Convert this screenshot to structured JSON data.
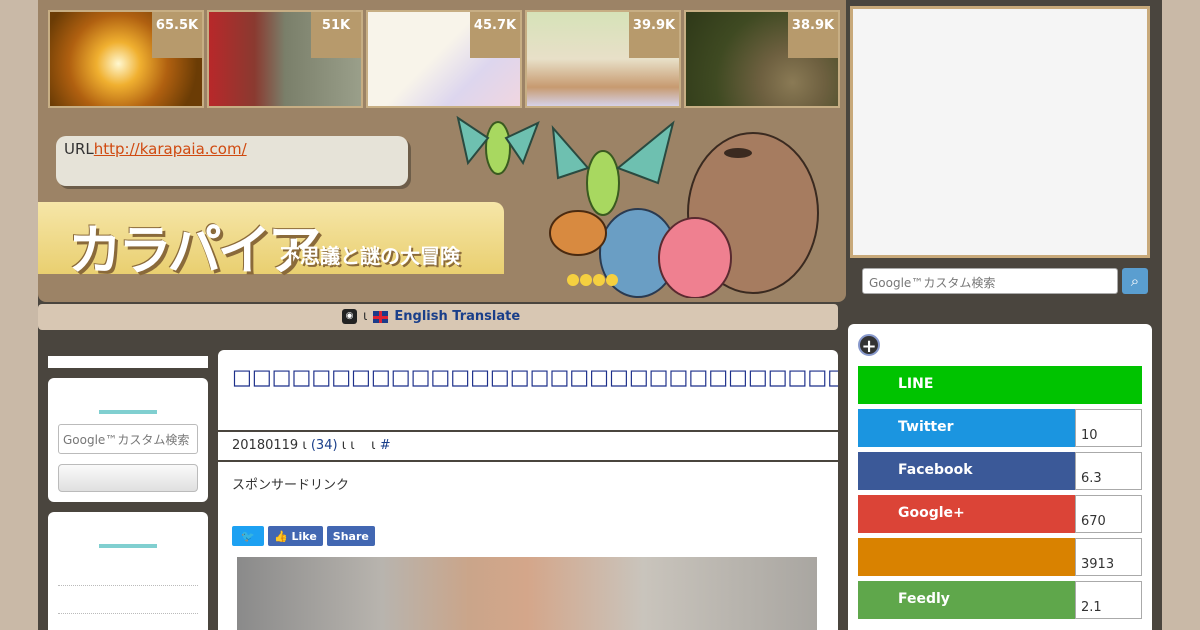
{
  "thumbnails": [
    {
      "count": "65.5K",
      "colors": [
        "#6b3c05",
        "#f0b030",
        "#ffe9a0"
      ]
    },
    {
      "count": "51K",
      "colors": [
        "#b8282a",
        "#7a7f6a",
        "#9a9f8a"
      ]
    },
    {
      "count": "45.7K",
      "colors": [
        "#f8f4ea",
        "#ddd6ee",
        "#f0d6e0"
      ]
    },
    {
      "count": "39.9K",
      "colors": [
        "#d6e2b8",
        "#c79a70",
        "#e8e0c8"
      ]
    },
    {
      "count": "38.9K",
      "colors": [
        "#3f4a22",
        "#6e6040",
        "#8a7a55"
      ]
    }
  ],
  "header": {
    "url_prefix": "URL",
    "url_text": "http://karapaia.com/",
    "logo_main": "カラパイア",
    "logo_sub": "不思議と謎の大冒険"
  },
  "translate": {
    "globe_icon": "globe-icon",
    "sep": "ι",
    "label": "English Translate"
  },
  "left_sidebar": {
    "search_placeholder": "Google™カスタム検索"
  },
  "article": {
    "title": "□□□□□□□□□□□□□□□□□□□□□□□□□□□□□□□□□□□□□□□□□□□□□□□□□□□□□□□□□",
    "date": "20180119",
    "sep1": "ι",
    "comments": "(34)",
    "sep2": "ι ι",
    "sep3": "ι",
    "hash": "#",
    "sponsored": "スポンサードリンク",
    "like_label": "Like",
    "share_label": "Share"
  },
  "right_sidebar": {
    "search_placeholder": "Google™カスタム検索",
    "shares": [
      {
        "label": "LINE",
        "count": "",
        "color": "#00c300"
      },
      {
        "label": "Twitter",
        "count": "10",
        "color": "#1b95e0"
      },
      {
        "label": "Facebook",
        "count": "6.3",
        "color": "#3b5998"
      },
      {
        "label": "Google+",
        "count": "670",
        "color": "#db4437"
      },
      {
        "label": "",
        "count": "3913",
        "color": "#d98200"
      },
      {
        "label": "Feedly",
        "count": "2.1",
        "color": "#5fa74b"
      }
    ]
  }
}
